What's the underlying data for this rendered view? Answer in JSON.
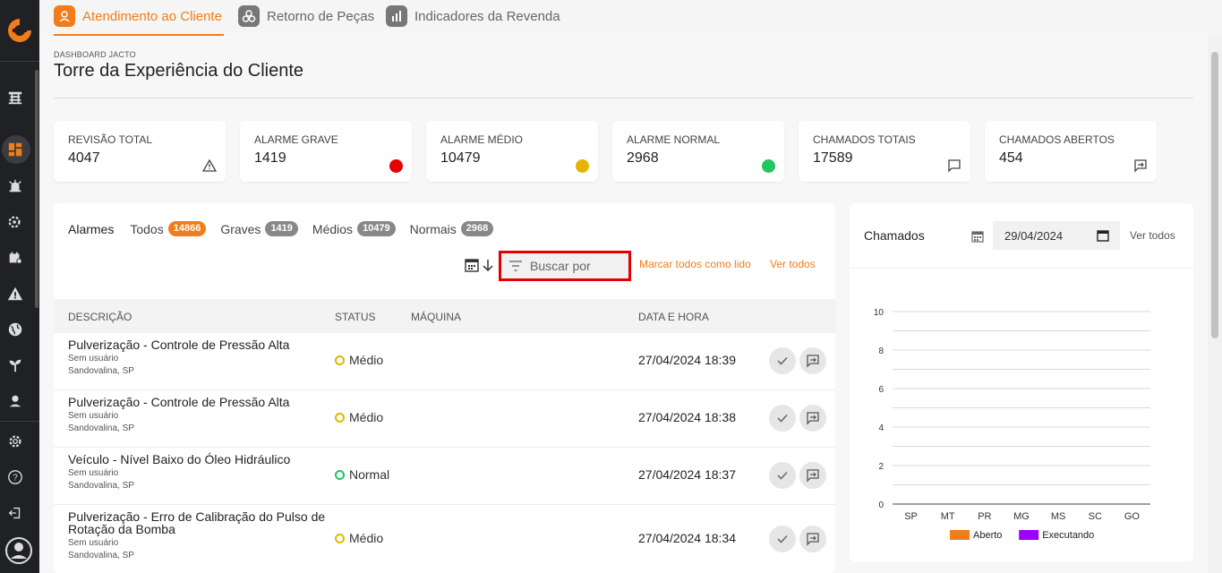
{
  "tabs": [
    {
      "label": "Atendimento ao Cliente",
      "active": true
    },
    {
      "label": "Retorno de Peças",
      "active": false
    },
    {
      "label": "Indicadores da Revenda",
      "active": false
    }
  ],
  "header": {
    "eyebrow": "DASHBOARD JACTO",
    "title": "Torre da Experiência do Cliente"
  },
  "stats": [
    {
      "label": "REVISÃO TOTAL",
      "value": "4047",
      "icon": "warning-icon"
    },
    {
      "label": "ALARME GRAVE",
      "value": "1419",
      "color": "#e60000"
    },
    {
      "label": "ALARME MÉDIO",
      "value": "10479",
      "color": "#e6b400"
    },
    {
      "label": "ALARME NORMAL",
      "value": "2968",
      "color": "#22c55e"
    },
    {
      "label": "CHAMADOS TOTAIS",
      "value": "17589",
      "icon": "chat-icon"
    },
    {
      "label": "CHAMADOS ABERTOS",
      "value": "454",
      "icon": "forward-message-icon"
    }
  ],
  "alarms": {
    "title": "Alarmes",
    "filters": [
      {
        "label": "Todos",
        "count": "14866"
      },
      {
        "label": "Graves",
        "count": "1419"
      },
      {
        "label": "Médios",
        "count": "10479"
      },
      {
        "label": "Normais",
        "count": "2968"
      }
    ],
    "search_placeholder": "Buscar por",
    "mark_all_read": "Marcar todos como lido",
    "see_all": "Ver todos",
    "columns": [
      "DESCRIÇÃO",
      "STATUS",
      "MÁQUINA",
      "DATA E HORA"
    ],
    "rows": [
      {
        "title": "Pulverização - Controle de Pressão Alta",
        "user": "Sem usuário",
        "location": "Sandovalina, SP",
        "status": "Médio",
        "datetime": "27/04/2024 18:39"
      },
      {
        "title": "Pulverização - Controle de Pressão Alta",
        "user": "Sem usuário",
        "location": "Sandovalina, SP",
        "status": "Médio",
        "datetime": "27/04/2024 18:38"
      },
      {
        "title": "Veículo - Nível Baixo do Óleo Hidráulico",
        "user": "Sem usuário",
        "location": "Sandovalina, SP",
        "status": "Normal",
        "datetime": "27/04/2024 18:37"
      },
      {
        "title": "Pulverização - Erro de Calibração do Pulso de Rotação da Bomba",
        "user": "Sem usuário",
        "location": "Sandovalina, SP",
        "status": "Médio",
        "datetime": "27/04/2024 18:34"
      }
    ]
  },
  "chamados": {
    "title": "Chamados",
    "date_value": "29/04/2024",
    "see_all": "Ver todos"
  },
  "chart_data": {
    "type": "bar",
    "categories": [
      "SP",
      "MT",
      "PR",
      "MG",
      "MS",
      "SC",
      "GO"
    ],
    "series": [
      {
        "name": "Aberto",
        "color": "#f07d1a",
        "values": [
          0,
          0,
          0,
          0,
          0,
          0,
          0
        ]
      },
      {
        "name": "Executando",
        "color": "#9b00ff",
        "values": [
          0,
          0,
          0,
          0,
          0,
          0,
          0
        ]
      }
    ],
    "yticks": [
      0,
      2,
      4,
      6,
      8,
      10
    ],
    "ylim": [
      0,
      10
    ],
    "legend": "bottom"
  }
}
